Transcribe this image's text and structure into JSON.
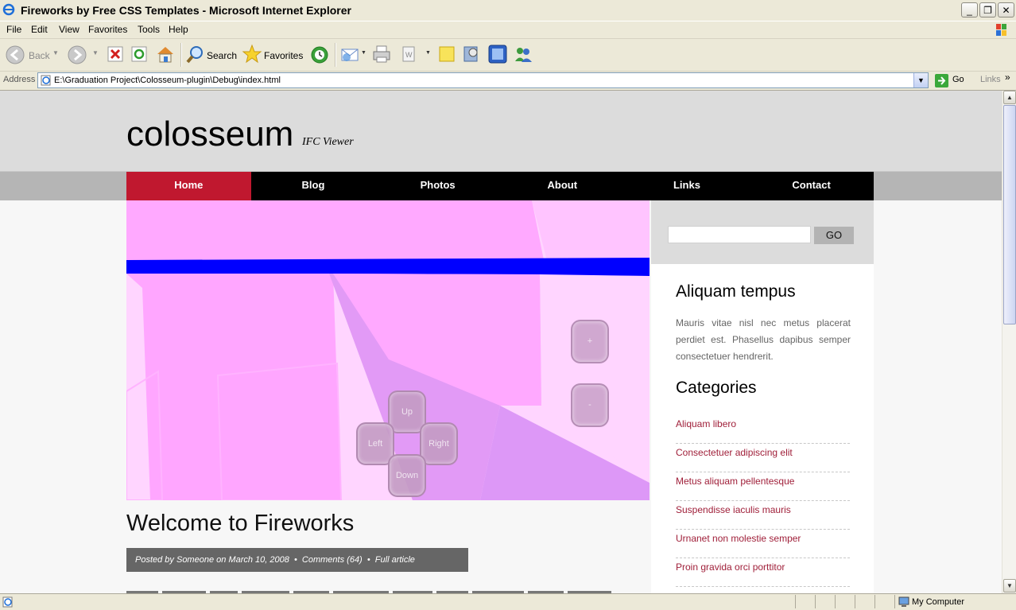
{
  "window": {
    "title": "Fireworks by Free CSS Templates - Microsoft Internet Explorer"
  },
  "menu": [
    "File",
    "Edit",
    "View",
    "Favorites",
    "Tools",
    "Help"
  ],
  "toolbar": {
    "back": "Back",
    "search": "Search",
    "favorites": "Favorites"
  },
  "address": {
    "label": "Address",
    "url": "E:\\Graduation Project\\Colosseum-plugin\\Debug\\index.html",
    "go": "Go",
    "links": "Links"
  },
  "site": {
    "logo": "colosseum",
    "tagline": "IFC Viewer"
  },
  "nav": [
    "Home",
    "Blog",
    "Photos",
    "About",
    "Links",
    "Contact"
  ],
  "viewer": {
    "zoom_in": "+",
    "zoom_out": "-",
    "up": "Up",
    "left": "Left",
    "right": "Right",
    "down": "Down"
  },
  "post": {
    "title": "Welcome to Fireworks",
    "meta": "Posted by Someone on March 10, 2008  •  Comments (64)  •  Full article"
  },
  "sidebar": {
    "search_go": "GO",
    "heading1": "Aliquam tempus",
    "text": "Mauris vitae nisl nec metus placerat perdiet est. Phasellus dapibus semper consectetuer hendrerit.",
    "heading2": "Categories",
    "categories": [
      "Aliquam libero",
      "Consectetuer adipiscing elit",
      "Metus aliquam pellentesque",
      "Suspendisse iaculis mauris",
      "Urnanet non molestie semper",
      "Proin gravida orci porttitor"
    ]
  },
  "status": {
    "zone": "My Computer"
  },
  "colors": {
    "nav_active": "#c0182f",
    "link": "#a0203a",
    "viewer_bg": "#ffd9ff"
  }
}
